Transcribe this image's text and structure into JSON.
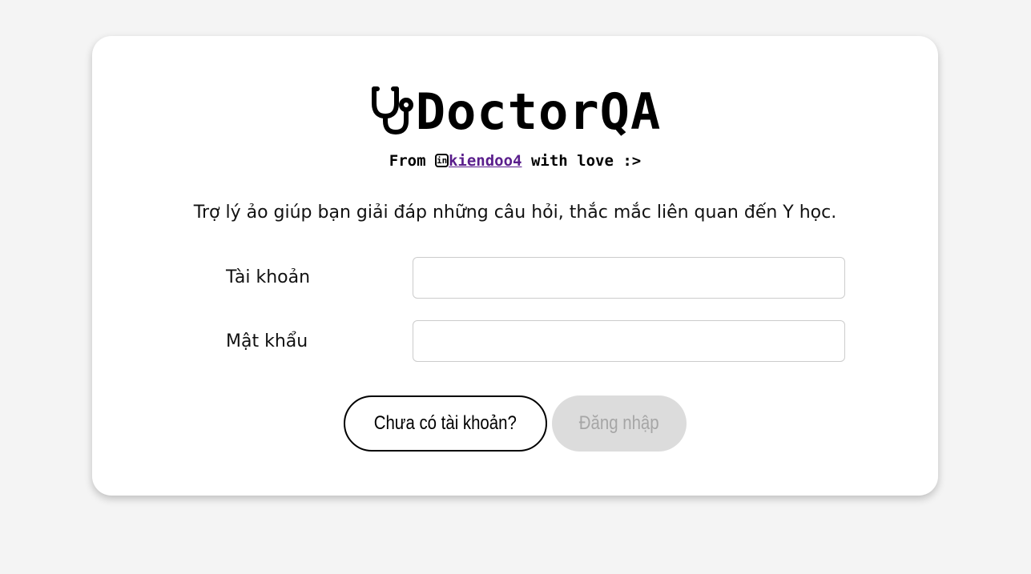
{
  "header": {
    "title": "DoctorQA",
    "from": "From",
    "author": "kiendoo4",
    "suffix": "with love :>",
    "linkedin_icon": "in"
  },
  "description": "Trợ lý ảo giúp bạn giải đáp những câu hỏi, thắc mắc liên quan đến Y học.",
  "form": {
    "username_label": "Tài khoản",
    "username_value": "",
    "password_label": "Mật khẩu",
    "password_value": "",
    "register_button": "Chưa có tài khoản?",
    "login_button": "Đăng nhập"
  }
}
